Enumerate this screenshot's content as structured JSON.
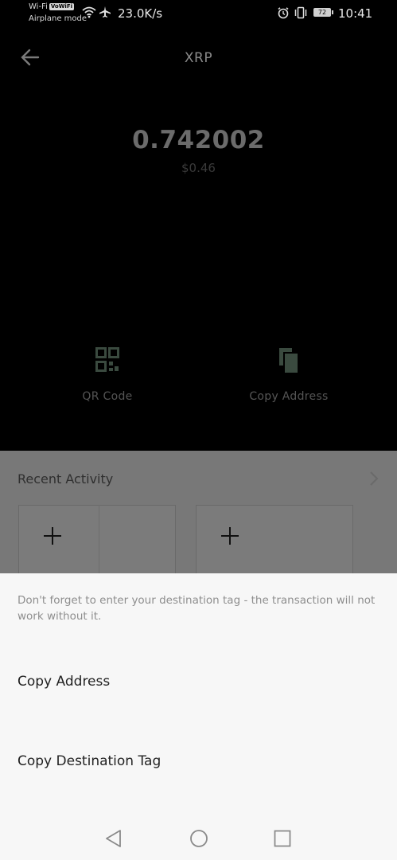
{
  "status_bar": {
    "wifi_label": "Wi-Fi",
    "wifi_badge": "VoWiFi",
    "airplane_mode_label": "Airplane mode",
    "net_speed": "23.0K/s",
    "battery_level": "72",
    "time": "10:41"
  },
  "header": {
    "title": "XRP"
  },
  "balance": {
    "amount": "0.742002",
    "fiat": "$0.46"
  },
  "actions": {
    "qr_label": "QR Code",
    "copy_label": "Copy Address"
  },
  "activity": {
    "title": "Recent Activity"
  },
  "sheet": {
    "note": "Don't forget to enter your destination tag - the transaction will not work without it.",
    "options": [
      "Copy Address",
      "Copy Destination Tag"
    ]
  },
  "icons": {
    "back": "arrow-left",
    "qr": "qr-code",
    "copy": "copy-document",
    "chevron": "chevron-right",
    "plus": "plus"
  },
  "colors": {
    "sheet_background": "#f7f7f7",
    "accent_icon": "#3a4a3f"
  }
}
